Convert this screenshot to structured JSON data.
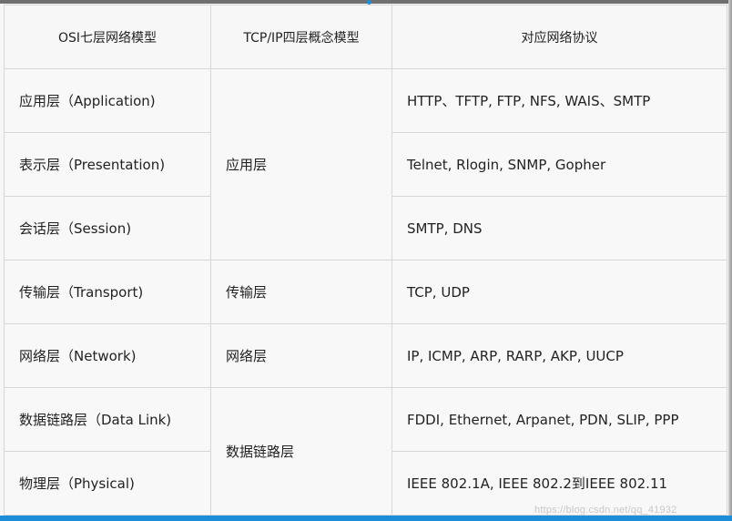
{
  "table": {
    "headers": [
      "OSI七层网络模型",
      "TCP/IP四层概念模型",
      "对应网络协议"
    ],
    "osi_layers": [
      "应用层（Application)",
      "表示层（Presentation)",
      "会话层（Session)",
      "传输层（Transport)",
      "网络层（Network)",
      "数据链路层（Data Link)",
      "物理层（Physical)"
    ],
    "tcpip_layers": [
      "应用层",
      "传输层",
      "网络层",
      "数据链路层"
    ],
    "protocols": [
      "HTTP、TFTP, FTP, NFS, WAIS、SMTP",
      "Telnet, Rlogin, SNMP, Gopher",
      "SMTP, DNS",
      "TCP, UDP",
      "IP, ICMP, ARP, RARP, AKP, UUCP",
      "FDDI, Ethernet, Arpanet, PDN, SLIP, PPP",
      "IEEE 802.1A, IEEE 802.2到IEEE 802.11"
    ]
  },
  "watermark": "https://blog.csdn.net/qq_41932",
  "colors": {
    "accent": "#1c8dd8",
    "cell_background": "#f8f8f8",
    "border": "#d7d7d7",
    "text": "#222222"
  }
}
